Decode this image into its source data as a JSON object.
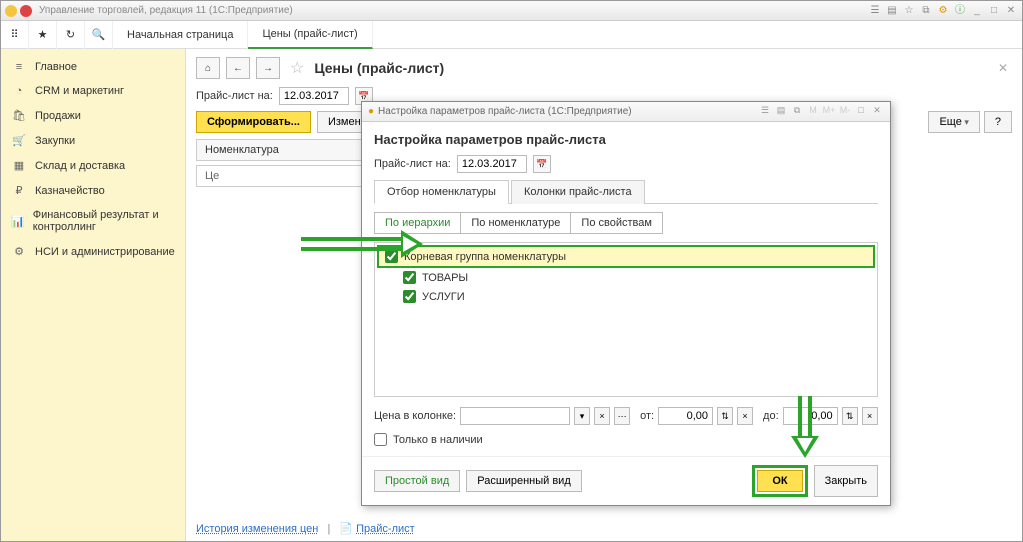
{
  "app": {
    "title": "Управление торговлей, редакция 11  (1С:Предприятие)"
  },
  "topTabs": {
    "start": "Начальная страница",
    "prices": "Цены (прайс-лист)"
  },
  "sidebar": {
    "items": [
      {
        "icon": "≡",
        "label": "Главное"
      },
      {
        "icon": "◔",
        "label": "CRM и маркетинг"
      },
      {
        "icon": "🛍",
        "label": "Продажи"
      },
      {
        "icon": "🛒",
        "label": "Закупки"
      },
      {
        "icon": "▦",
        "label": "Склад и доставка"
      },
      {
        "icon": "₽",
        "label": "Казначейство"
      },
      {
        "icon": "📊",
        "label": "Финансовый результат и контроллинг"
      },
      {
        "icon": "⚙",
        "label": "НСИ и администрирование"
      }
    ]
  },
  "page": {
    "title": "Цены (прайс-лист)",
    "dateLabel": "Прайс-лист на:",
    "date": "12.03.2017",
    "formBtn": "Сформировать...",
    "changeBtn": "Изменить цены",
    "moreBtn": "Еще",
    "helpBtn": "?",
    "tableHeader": "Номенклатура",
    "cellPrefix": "Це",
    "historyLink": "История изменения цен",
    "priceListLink": "Прайс-лист"
  },
  "modal": {
    "winTitle": "Настройка параметров прайс-листа  (1С:Предприятие)",
    "title": "Настройка параметров прайс-листа",
    "dateLabel": "Прайс-лист на:",
    "date": "12.03.2017",
    "tabs": {
      "filter": "Отбор номенклатуры",
      "columns": "Колонки прайс-листа"
    },
    "subTabs": {
      "hierarchy": "По иерархии",
      "nomenclature": "По номенклатуре",
      "properties": "По свойствам"
    },
    "tree": {
      "root": "Корневая группа номенклатуры",
      "goods": "ТОВАРЫ",
      "services": "УСЛУГИ"
    },
    "priceInColumn": "Цена в колонке:",
    "from": "от:",
    "to": "до:",
    "fromVal": "0,00",
    "toVal": "0,00",
    "inStock": "Только в наличии",
    "simpleView": "Простой вид",
    "extView": "Расширенный вид",
    "ok": "ОК",
    "close": "Закрыть"
  }
}
